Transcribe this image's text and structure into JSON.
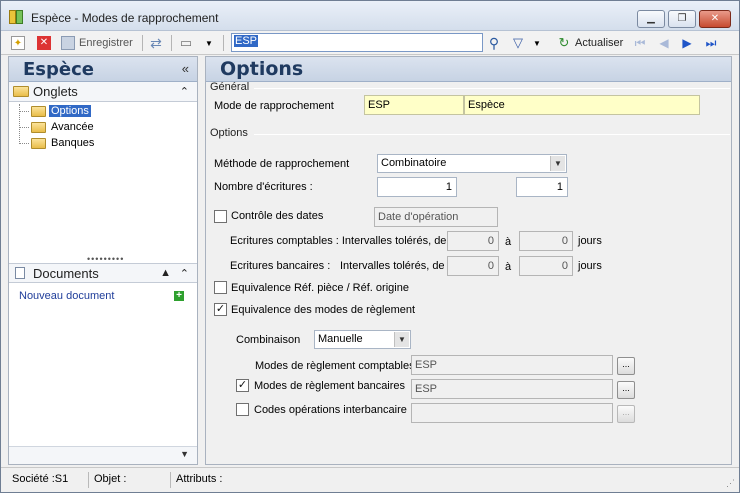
{
  "window": {
    "title": "Espèce -  Modes de rapprochement",
    "controls": [
      "minimize-icon",
      "restore-icon",
      "close-icon"
    ]
  },
  "toolbar": {
    "save_label": "Enregistrer",
    "search_value": "ESP",
    "refresh_label": "Actualiser"
  },
  "left": {
    "title": "Espèce",
    "collapse_glyph": "«",
    "onglets": {
      "title": "Onglets",
      "items": [
        {
          "label": "Options",
          "selected": true
        },
        {
          "label": "Avancée",
          "selected": false
        },
        {
          "label": "Banques",
          "selected": false
        }
      ]
    },
    "documents": {
      "title": "Documents",
      "new_label": "Nouveau document"
    }
  },
  "main": {
    "title": "Options",
    "general": {
      "title": "Général",
      "mode_label": "Mode de rapprochement",
      "mode_code": "ESP",
      "mode_name": "Espèce"
    },
    "options": {
      "title": "Options",
      "methode_label": "Méthode de rapprochement",
      "methode_value": "Combinatoire",
      "nb_label": "Nombre d'écritures :",
      "nb_value1": "1",
      "nb_value2": "1",
      "controle_dates_label": "Contrôle des dates",
      "controle_dates_checked": false,
      "date_field": "Date d'opération",
      "ecr_comptables_label": "Ecritures comptables : Intervalles tolérés, de",
      "ecr_comptables_from": "0",
      "ecr_comptables_to": "0",
      "a_label": "à",
      "jours_label": "jours",
      "ecr_bancaires_label_a": "Ecritures bancaires :",
      "ecr_bancaires_label_b": "Intervalles tolérés, de",
      "ecr_bancaires_from": "0",
      "ecr_bancaires_to": "0",
      "equiv_ref_label": "Equivalence Réf. pièce / Réf. origine",
      "equiv_ref_checked": false,
      "equiv_modes_label": "Equivalence des modes de règlement",
      "equiv_modes_checked": true,
      "combinaison_label": "Combinaison",
      "combinaison_value": "Manuelle",
      "modes_comptables_label": "Modes de règlement comptables",
      "modes_comptables_value": "ESP",
      "modes_bancaires_label": "Modes de règlement bancaires",
      "modes_bancaires_checked": true,
      "modes_bancaires_value": "ESP",
      "codes_interbancaire_label": "Codes opérations interbancaire",
      "codes_interbancaire_checked": false,
      "codes_interbancaire_value": "",
      "dots_label": "..."
    }
  },
  "status": {
    "societe": "Société :S1",
    "objet": "Objet :",
    "attributs": "Attributs :"
  }
}
